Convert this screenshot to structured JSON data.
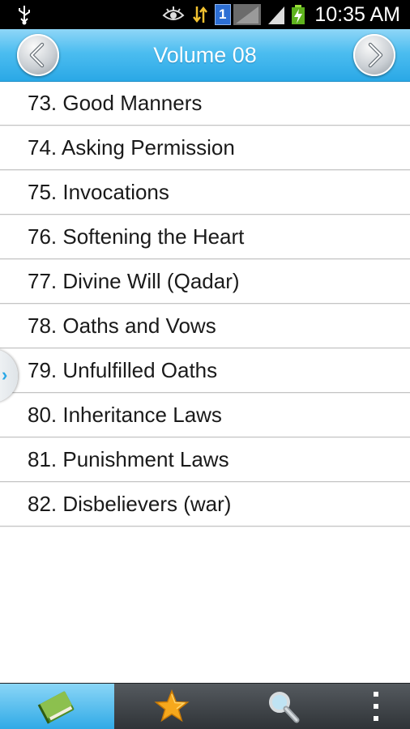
{
  "status_bar": {
    "time": "10:35 AM",
    "sim_slot": "1",
    "icons": [
      "usb-icon",
      "eye-icon",
      "data-transfer-icon",
      "sim-icon",
      "signal-weak-icon",
      "signal-icon",
      "battery-charging-icon"
    ]
  },
  "header": {
    "title": "Volume 08",
    "prev_icon": "chevron-left-icon",
    "next_icon": "chevron-right-icon"
  },
  "chapters": [
    "73. Good Manners",
    "74. Asking Permission",
    "75. Invocations",
    "76. Softening the Heart",
    "77. Divine Will (Qadar)",
    "78. Oaths and Vows",
    "79. Unfulfilled Oaths",
    "80. Inheritance Laws",
    "81. Punishment Laws",
    "82. Disbelievers (war)"
  ],
  "drawer_handle": {
    "glyph": "›"
  },
  "bottom_tabs": [
    {
      "icon": "book-icon",
      "active": true
    },
    {
      "icon": "star-icon",
      "active": false
    },
    {
      "icon": "search-icon",
      "active": false
    },
    {
      "icon": "overflow-menu-icon",
      "active": false
    }
  ],
  "colors": {
    "accent": "#2aa8e6",
    "header_top": "#8fd6f7",
    "bottom_bar": "#3a3e42",
    "star": "#f6a81c",
    "book": "#6fa63a"
  }
}
